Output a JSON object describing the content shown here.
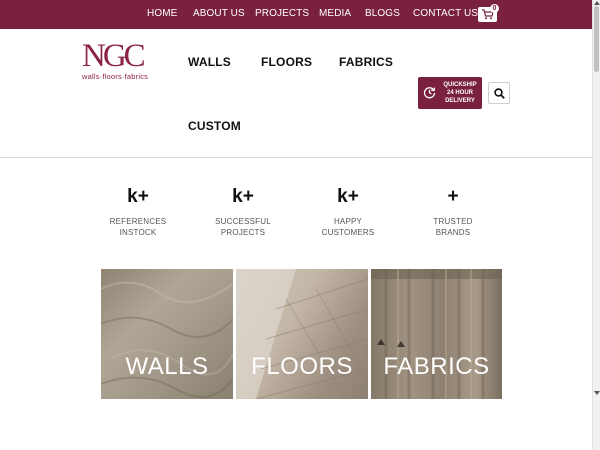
{
  "topbar": {
    "links": [
      "HOME",
      "ABOUT US",
      "PROJECTS",
      "MEDIA",
      "BLOGS",
      "CONTACT US"
    ],
    "cart_count": "0",
    "cart_icon": "cart-icon",
    "bg_color": "#7a2040"
  },
  "logo": {
    "mark": "NGC",
    "tagline": "walls·floors·fabrics",
    "color": "#8b2248"
  },
  "mainnav": {
    "items": [
      "WALLS",
      "FLOORS",
      "FABRICS",
      "CUSTOM"
    ]
  },
  "quickship": {
    "line1": "QUICKSHIP",
    "line2": "24 HOUR",
    "line3": "DELIVERY",
    "icon": "clock-refresh-icon"
  },
  "search": {
    "icon": "search-icon"
  },
  "stats": [
    {
      "value": "k+",
      "label_line1": "REFERENCES",
      "label_line2": "INSTOCK"
    },
    {
      "value": "k+",
      "label_line1": "SUCCESSFUL",
      "label_line2": "PROJECTS"
    },
    {
      "value": "k+",
      "label_line1": "HAPPY",
      "label_line2": "CUSTOMERS"
    },
    {
      "value": "+",
      "label_line1": "TRUSTED",
      "label_line2": "BRANDS"
    }
  ],
  "tiles": [
    {
      "label": "WALLS"
    },
    {
      "label": "FLOORS"
    },
    {
      "label": "FABRICS"
    }
  ]
}
